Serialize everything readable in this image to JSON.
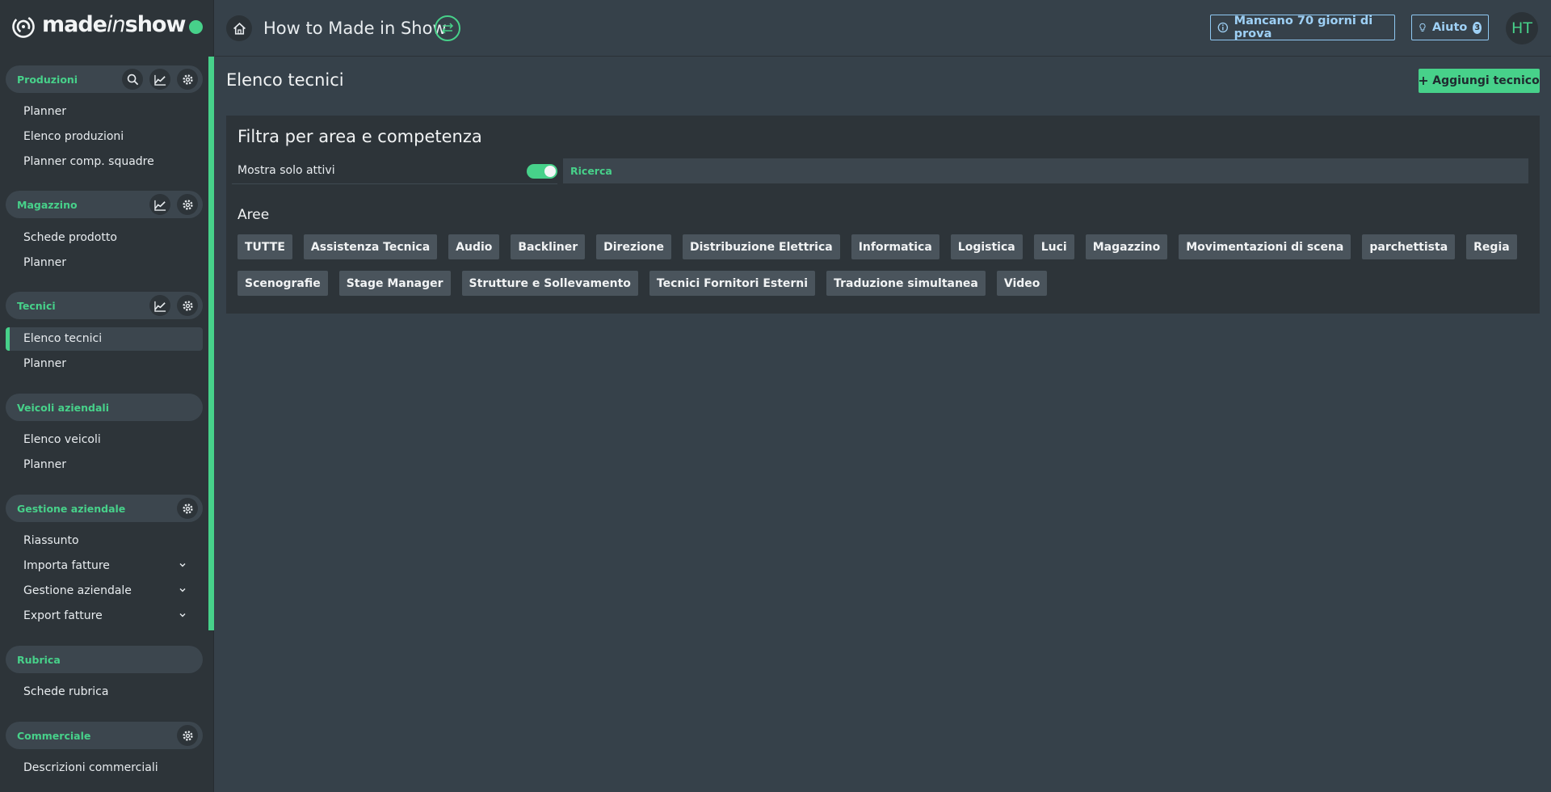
{
  "brand": {
    "name_part1": "made",
    "name_part2": "in",
    "name_part3": "show",
    "accent": "#47d18a"
  },
  "topbar": {
    "title": "How to Made in Show",
    "trial": "Mancano 70 giorni di prova",
    "help": "Aiuto",
    "help_count": "3",
    "avatar": "HT"
  },
  "sidebar": {
    "sections": [
      {
        "label": "Produzioni",
        "items": [
          "Planner",
          "Elenco produzioni",
          "Planner comp. squadre"
        ]
      },
      {
        "label": "Magazzino",
        "items": [
          "Schede prodotto",
          "Planner"
        ]
      },
      {
        "label": "Tecnici",
        "items": [
          "Elenco tecnici",
          "Planner"
        ]
      },
      {
        "label": "Veicoli aziendali",
        "items": [
          "Elenco veicoli",
          "Planner"
        ]
      },
      {
        "label": "Gestione aziendale",
        "items": [
          "Riassunto",
          "Importa fatture",
          "Gestione aziendale",
          "Export fatture"
        ]
      },
      {
        "label": "Rubrica",
        "items": [
          "Schede rubrica"
        ]
      },
      {
        "label": "Commerciale",
        "items": [
          "Descrizioni commerciali"
        ]
      }
    ]
  },
  "main": {
    "page_title": "Elenco tecnici",
    "add_button": "Aggiungi tecnico",
    "filter": {
      "title": "Filtra per area e competenza",
      "active_only_label": "Mostra solo attivi",
      "active_only": true,
      "search_placeholder": "Ricerca",
      "areas_label": "Aree",
      "areas": [
        "TUTTE",
        "Assistenza Tecnica",
        "Audio",
        "Backliner",
        "Direzione",
        "Distribuzione Elettrica",
        "Informatica",
        "Logistica",
        "Luci",
        "Magazzino",
        "Movimentazioni di scena",
        "parchettista",
        "Regia",
        "Scenografie",
        "Stage Manager",
        "Strutture e Sollevamento",
        "Tecnici Fornitori Esterni",
        "Traduzione simultanea",
        "Video"
      ]
    }
  }
}
